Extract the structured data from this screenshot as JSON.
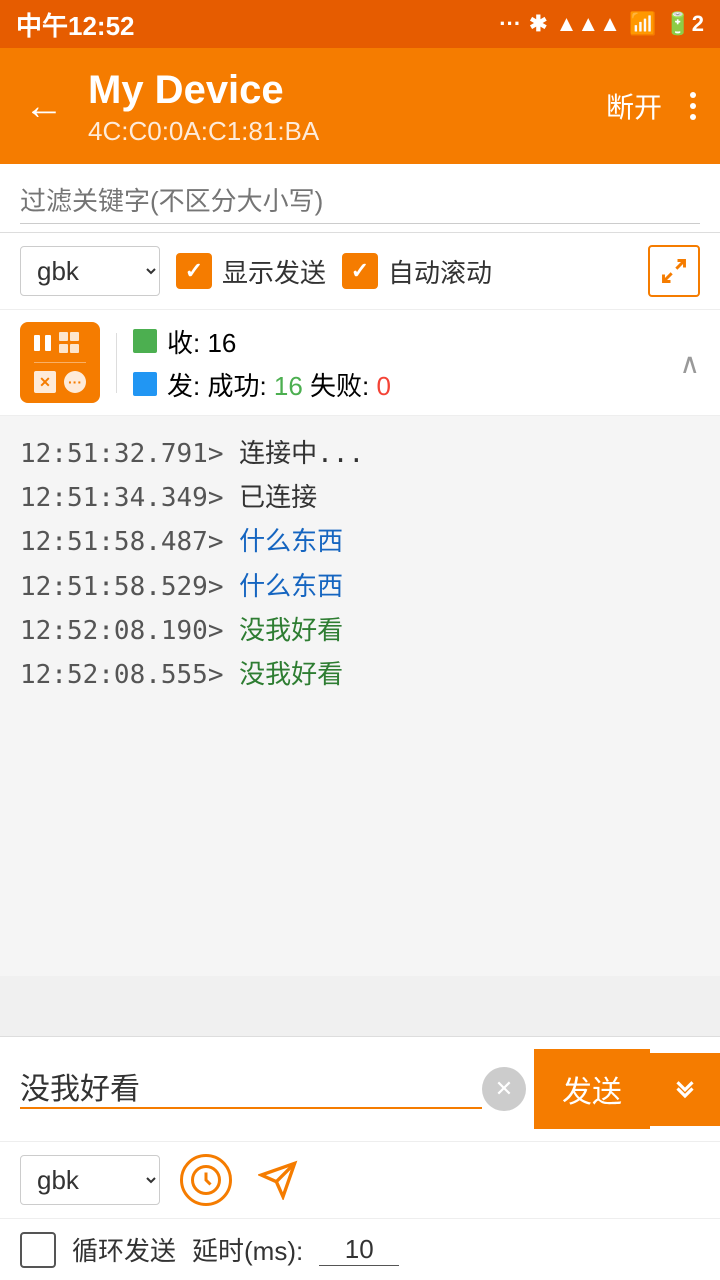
{
  "statusBar": {
    "time": "中午12:52",
    "battery": "2"
  },
  "appBar": {
    "title": "My Device",
    "subtitle": "4C:C0:0A:C1:81:BA",
    "disconnectLabel": "断开",
    "backLabel": "←"
  },
  "filter": {
    "placeholder": "过滤关键字(不区分大小写)"
  },
  "controls": {
    "encoding": "gbk",
    "showSendLabel": "显示发送",
    "autoScrollLabel": "自动滚动"
  },
  "stats": {
    "recvLabel": "收: 16",
    "sendLabel": "发: 成功: 16 失败: 0",
    "successCount": "16",
    "failCount": "0"
  },
  "log": {
    "lines": [
      {
        "timestamp": "12:51:32.791>",
        "message": " 连接中...",
        "type": "normal"
      },
      {
        "timestamp": "12:51:34.349>",
        "message": " 已连接",
        "type": "normal"
      },
      {
        "timestamp": "12:51:58.487>",
        "message": " 什么东西",
        "type": "blue"
      },
      {
        "timestamp": "12:51:58.529>",
        "message": " 什么东西",
        "type": "blue"
      },
      {
        "timestamp": "12:52:08.190>",
        "message": " 没我好看",
        "type": "green"
      },
      {
        "timestamp": "12:52:08.555>",
        "message": " 没我好看",
        "type": "green"
      }
    ]
  },
  "sendInput": {
    "value": "没我好看",
    "sendLabel": "发送"
  },
  "bottomControls": {
    "encoding": "gbk"
  },
  "loopRow": {
    "label": "循环发送",
    "delayLabel": "延时(ms):",
    "delayValue": "10"
  }
}
